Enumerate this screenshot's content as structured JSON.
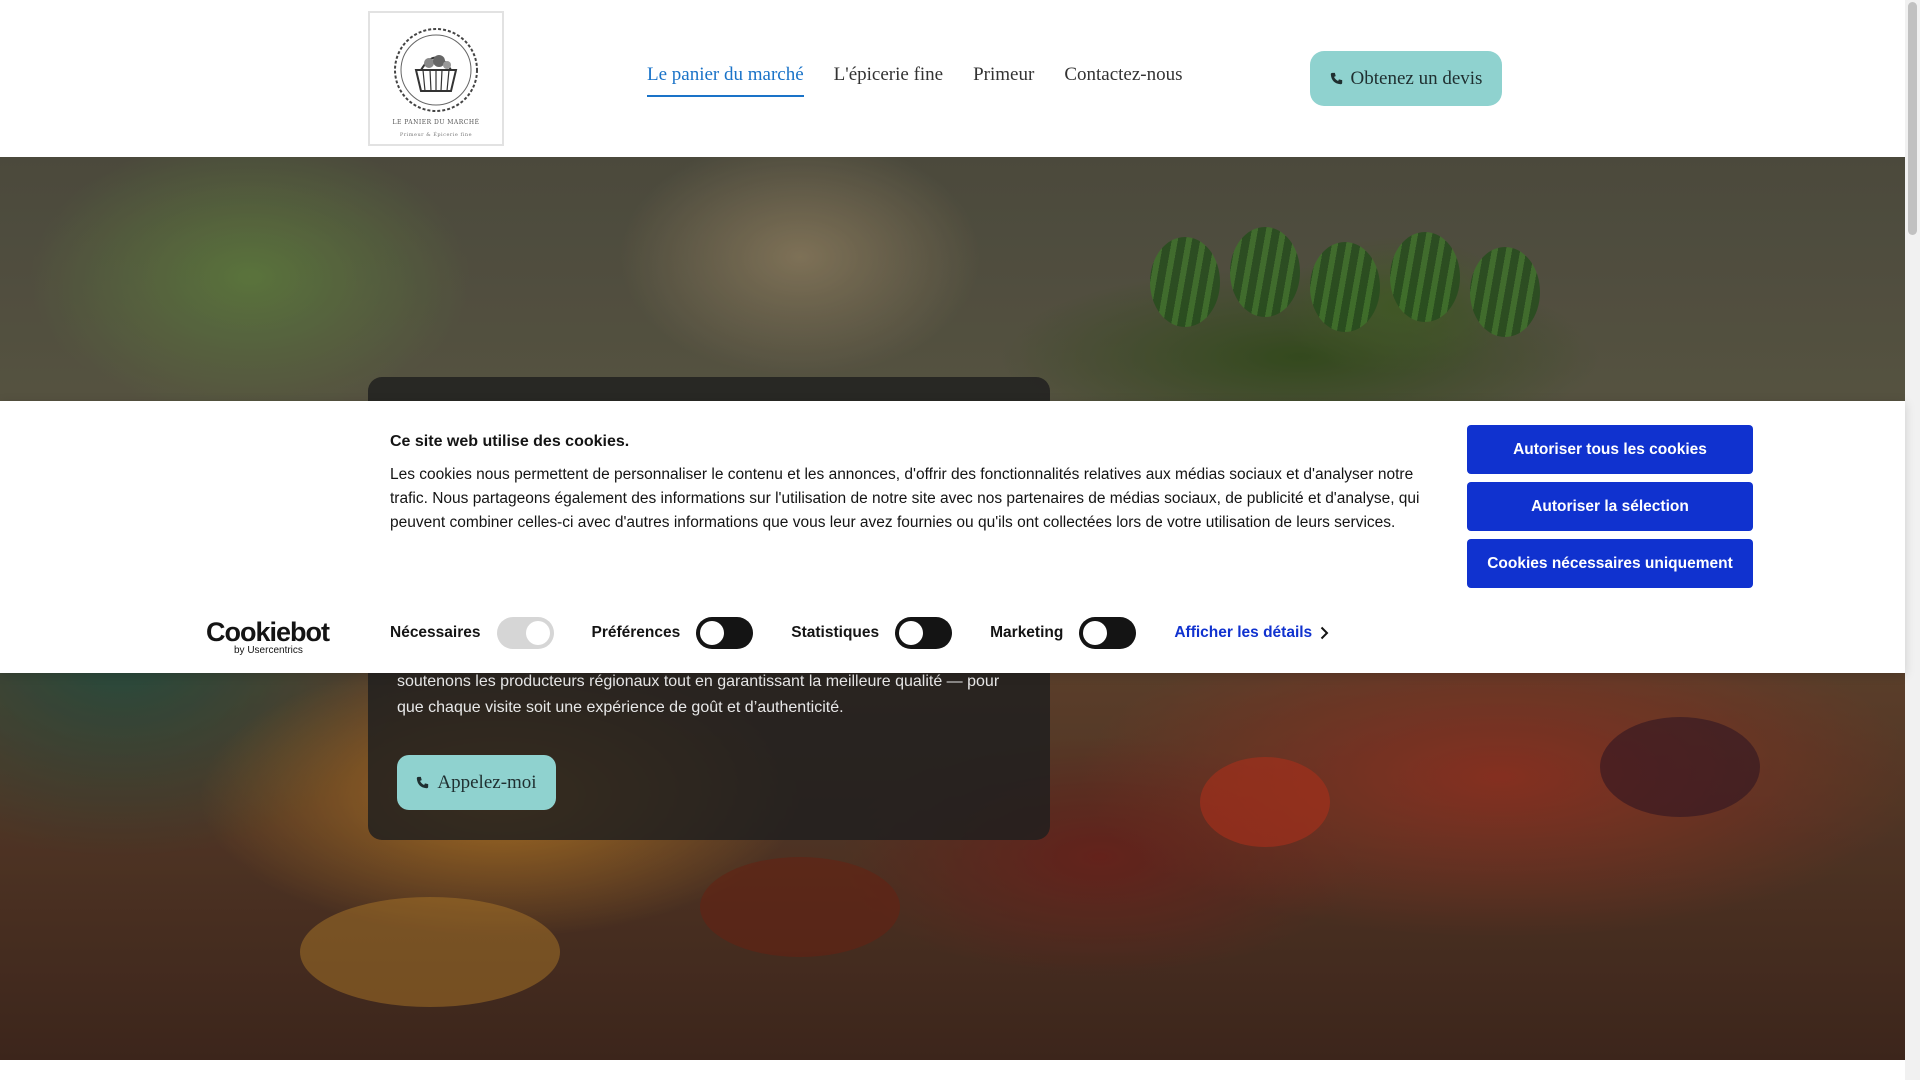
{
  "header": {
    "logo": {
      "line1": "LE PANIER DU MARCHÉ",
      "line2": "Primeur & Épicerie fine"
    },
    "nav": [
      {
        "label": "Le panier du marché",
        "active": true
      },
      {
        "label": "L'épicerie fine",
        "active": false
      },
      {
        "label": "Primeur",
        "active": false
      },
      {
        "label": "Contactez-nous",
        "active": false
      }
    ],
    "cta_label": "Obtenez un devis",
    "cta_icon": "phone-icon"
  },
  "hero": {
    "text": "soutenons les producteurs régionaux tout en garantissant la meilleure qualité — pour que chaque visite soit une expérience de goût et d’authenticité.",
    "button_label": "Appelez-moi",
    "button_icon": "phone-icon"
  },
  "cookie_banner": {
    "brand": "Cookiebot",
    "brand_sub": "by Usercentrics",
    "title": "Ce site web utilise des cookies.",
    "text": "Les cookies nous permettent de personnaliser le contenu et les annonces, d'offrir des fonctionnalités relatives aux médias sociaux et d'analyser notre trafic. Nous partageons également des informations sur l'utilisation de notre site avec nos partenaires de médias sociaux, de publicité et d'analyse, qui peuvent combiner celles-ci avec d'autres informations que vous leur avez fournies ou qu'ils ont collectées lors de votre utilisation de leurs services.",
    "toggles": [
      {
        "label": "Nécessaires",
        "state": "on-disabled"
      },
      {
        "label": "Préférences",
        "state": "off"
      },
      {
        "label": "Statistiques",
        "state": "off"
      },
      {
        "label": "Marketing",
        "state": "off"
      }
    ],
    "details_label": "Afficher les détails",
    "buttons": [
      "Autoriser tous les cookies",
      "Autoriser la sélection",
      "Cookies nécessaires uniquement"
    ]
  },
  "colors": {
    "accent_nav": "#1a73c8",
    "cta_bg": "#8fd2cf",
    "cookie_button": "#1032cf",
    "cookie_link": "#1032cf"
  }
}
